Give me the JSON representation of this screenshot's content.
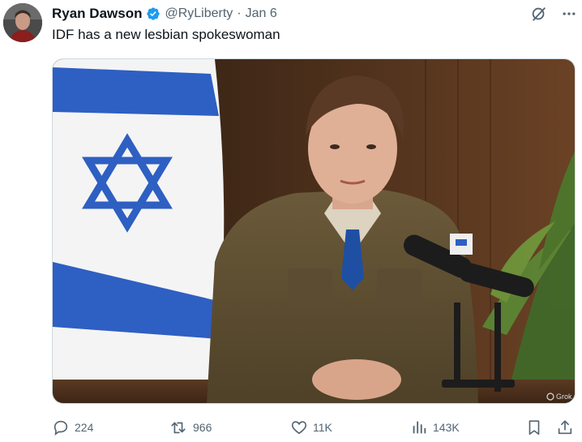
{
  "tweet": {
    "author_name": "Ryan Dawson",
    "handle": "@RyLiberty",
    "separator": "·",
    "date": "Jan 6",
    "text": "IDF has a new lesbian spokeswoman",
    "verified": true
  },
  "media": {
    "watermark": "Grok"
  },
  "actions": {
    "replies": "224",
    "reposts": "966",
    "likes": "11K",
    "views": "143K"
  },
  "icons": {
    "verified": "verified-badge-icon",
    "grok": "grok-icon",
    "more": "more-icon",
    "reply": "reply-icon",
    "repost": "repost-icon",
    "like": "like-icon",
    "views": "views-icon",
    "bookmark": "bookmark-icon",
    "share": "share-icon"
  },
  "colors": {
    "accent": "#1d9bf0",
    "text": "#0f1419",
    "secondary": "#536471",
    "flag_blue": "#2e5fc2"
  }
}
